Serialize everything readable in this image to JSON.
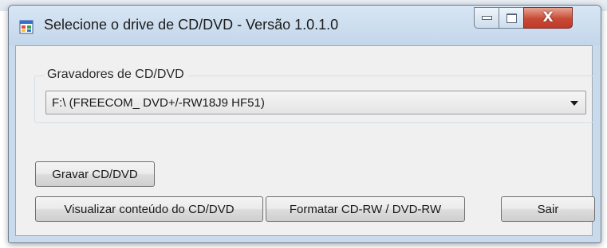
{
  "window": {
    "title": "Selecione o drive de CD/DVD - Versão 1.0.1.0",
    "icon": "app-window-icon",
    "caption_buttons": [
      "minimize-icon",
      "maximize-icon",
      "close-icon"
    ],
    "close_glyph": "X"
  },
  "drives": {
    "group_label": "Gravadores de CD/DVD",
    "selected": "F:\\ (FREECOM_ DVD+/-RW18J9 HF51)"
  },
  "buttons": {
    "gravar": "Gravar CD/DVD",
    "visualizar": "Visualizar conteúdo do CD/DVD",
    "formatar": "Formatar CD-RW / DVD-RW",
    "sair": "Sair"
  },
  "colors": {
    "title_bar": "#c9daea",
    "close_button": "#c74a35",
    "client_background": "#f0f0f0"
  }
}
